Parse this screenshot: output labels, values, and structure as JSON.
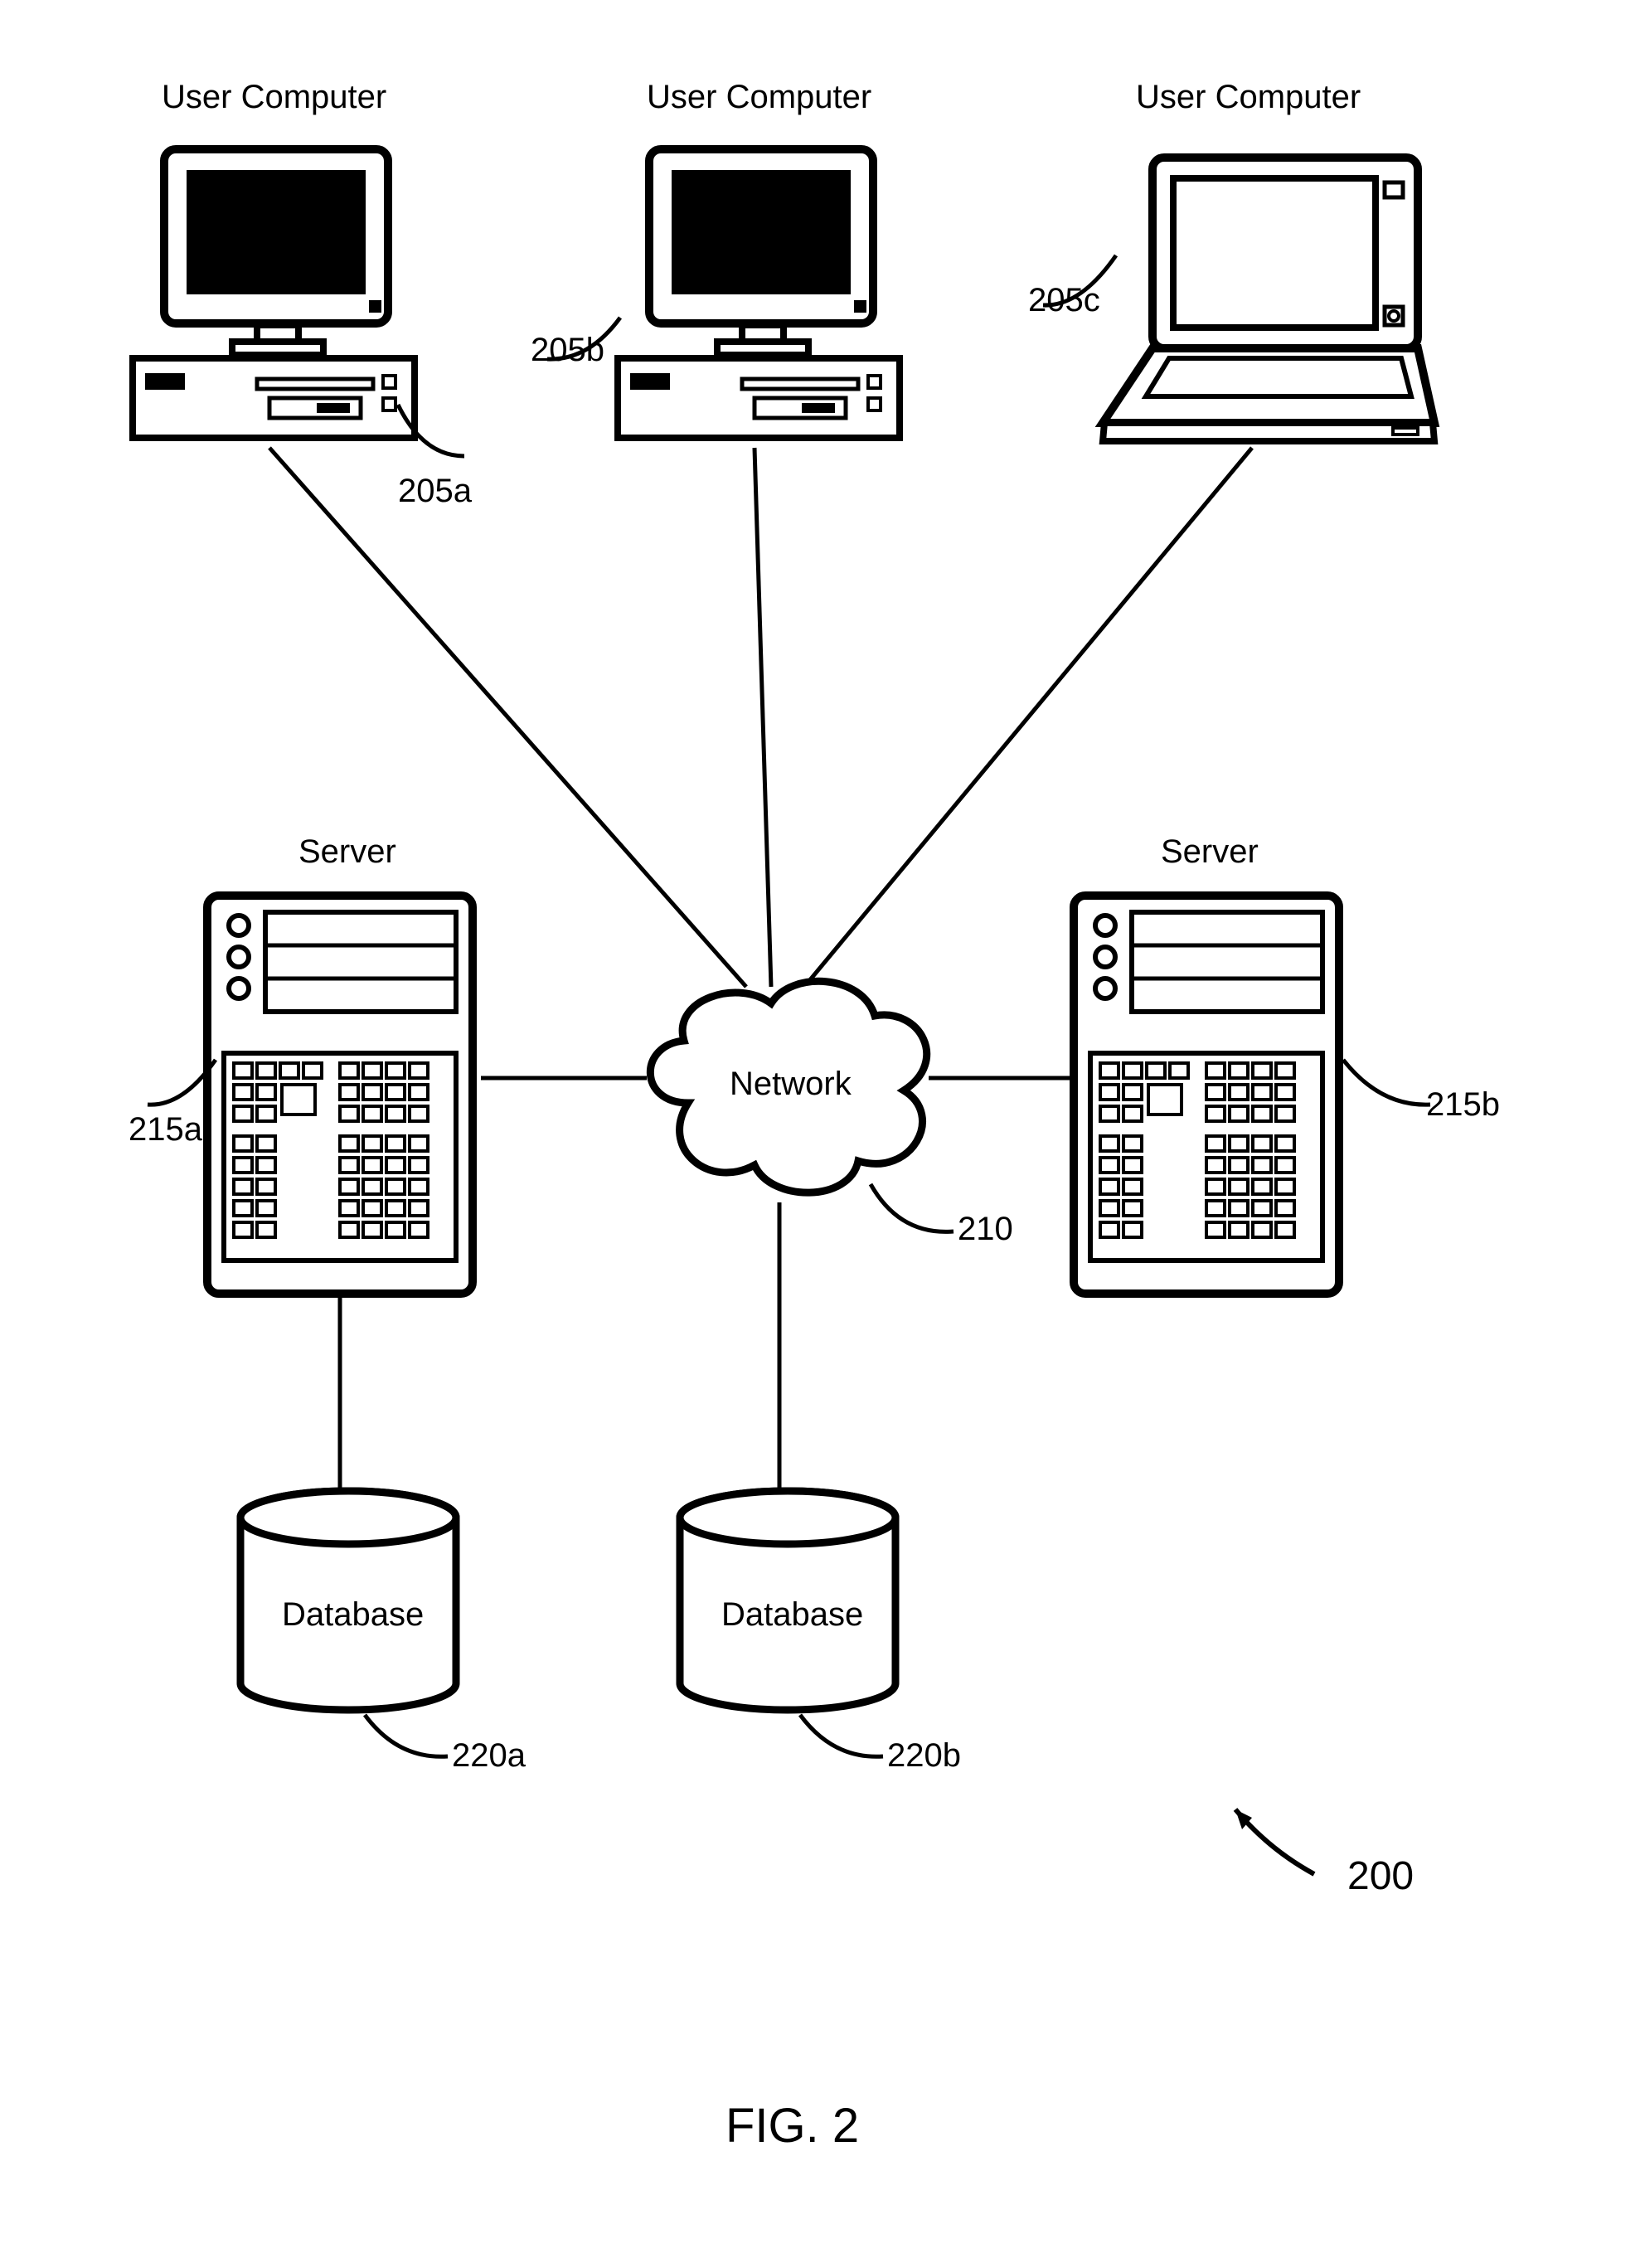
{
  "figure": {
    "caption": "FIG. 2",
    "overall_ref": "200"
  },
  "nodes": {
    "user_computer_a": {
      "label": "User Computer",
      "ref": "205a"
    },
    "user_computer_b": {
      "label": "User Computer",
      "ref": "205b"
    },
    "user_computer_c": {
      "label": "User Computer",
      "ref": "205c"
    },
    "server_a": {
      "label": "Server",
      "ref": "215a"
    },
    "server_b": {
      "label": "Server",
      "ref": "215b"
    },
    "network": {
      "label": "Network",
      "ref": "210"
    },
    "database_a": {
      "label": "Database",
      "ref": "220a"
    },
    "database_b": {
      "label": "Database",
      "ref": "220b"
    }
  }
}
